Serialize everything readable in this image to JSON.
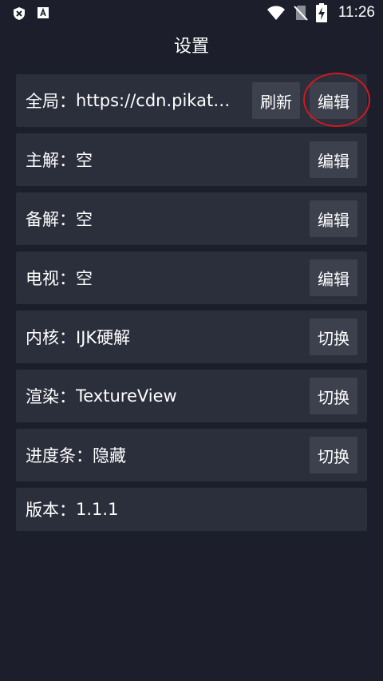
{
  "status_bar": {
    "time": "11:26",
    "icons": [
      "shield-icon",
      "font-a-icon",
      "wifi-icon",
      "no-sim-icon",
      "battery-charging-icon"
    ]
  },
  "title": "设置",
  "rows": [
    {
      "label": "全局：",
      "value": "https://cdn.pikatv.com/pikatv.json",
      "buttons": [
        "刷新",
        "编辑"
      ]
    },
    {
      "label": "主解：",
      "value": "空",
      "buttons": [
        "编辑"
      ]
    },
    {
      "label": "备解：",
      "value": "空",
      "buttons": [
        "编辑"
      ]
    },
    {
      "label": "电视：",
      "value": "空",
      "buttons": [
        "编辑"
      ]
    },
    {
      "label": "内核：",
      "value": "IJK硬解",
      "buttons": [
        "切换"
      ]
    },
    {
      "label": "渲染：",
      "value": "TextureView",
      "buttons": [
        "切换"
      ]
    },
    {
      "label": "进度条：",
      "value": "隐藏",
      "buttons": [
        "切换"
      ]
    },
    {
      "label": "版本：",
      "value": "1.1.1",
      "buttons": []
    }
  ],
  "colors": {
    "background": "#1c1f2b",
    "row": "#2b2e3b",
    "button": "#3d414e",
    "highlight": "#d0191e"
  }
}
